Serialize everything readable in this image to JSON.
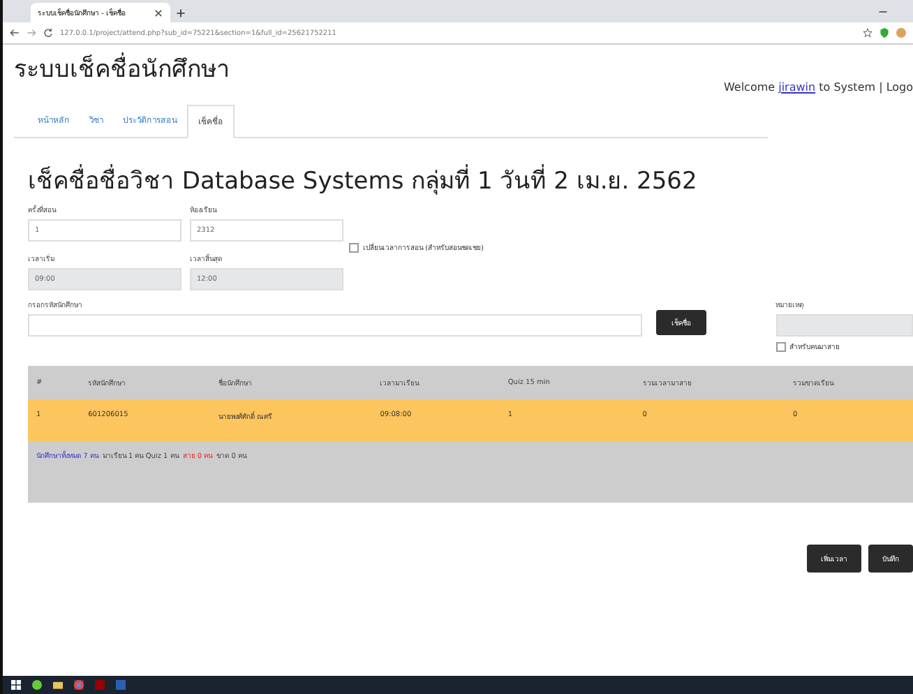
{
  "browser": {
    "tab_title": "ระบบเช็คชื่อนักศึกษา - เช็คชื่อ",
    "url": "127.0.0.1/project/attend.php?sub_id=75221&section=1&full_id=25621752211"
  },
  "site_title": "ระบบเช็คชื่อนักศึกษา",
  "welcome": {
    "before": "Welcome",
    "user": "jirawin",
    "after": "to System | Logo"
  },
  "tabs": [
    {
      "label": "หน้าหลัก",
      "selected": false
    },
    {
      "label": "วิชา",
      "selected": false
    },
    {
      "label": "ประวัติการสอน",
      "selected": false
    },
    {
      "label": "เช็คชื่อ",
      "selected": true
    }
  ],
  "heading": "เช็คชื่อชื่อวิชา Database Systems กลุ่มที่ 1 วันที่ 2 เม.ย. 2562",
  "fields": [
    {
      "label": "ครั้งที่สอน",
      "value": "1",
      "disabled": false
    },
    {
      "label": "ห้องเรียน",
      "value": "2312",
      "disabled": false
    },
    {
      "label": "เวลาเริ่ม",
      "value": "09:00",
      "disabled": true
    },
    {
      "label": "เวลาสิ้นสุด",
      "value": "12:00",
      "disabled": true
    }
  ],
  "change_time": {
    "label": "เปลี่ยนเวลาการสอน (สำหรับสอนชดเชย)",
    "checked": false
  },
  "student_id": {
    "label": "กรอกรหัสนักศึกษา",
    "button": "เช็คชื่อ"
  },
  "note": {
    "label": "หมายเหตุ",
    "late": {
      "label": "สำหรับคนมาสาย",
      "checked": false
    }
  },
  "table": {
    "columns": [
      "#",
      "รหัสนักศึกษา",
      "ชื่อนักศึกษา",
      "เวลามาเรียน",
      "Quiz 15 min",
      "รวมเวลามาสาย",
      "รวมขาดเรียน"
    ],
    "rows": [
      {
        "cells": [
          "1",
          "601206015",
          "นายพงศ์ศักดิ์ ณศรี",
          "09:08:00",
          "1",
          "0",
          "0"
        ],
        "selected": true
      }
    ],
    "summary": [
      {
        "text": "นักศึกษาทั้งหมด 7 คน",
        "kind": "link"
      },
      {
        "text": "มาเรียน 1 คน Quiz 1 คน",
        "kind": "plain"
      },
      {
        "text": "สาย 0 คน",
        "kind": "alert"
      },
      {
        "text": "ขาด 0 คน",
        "kind": "plain"
      }
    ]
  },
  "buttons": [
    "เพิ่มเวลา",
    "บันทึก"
  ]
}
